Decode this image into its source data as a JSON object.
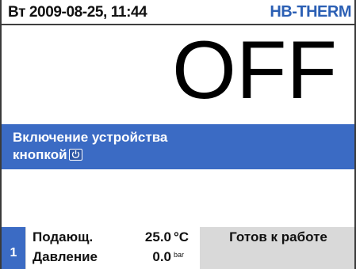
{
  "topbar": {
    "datetime": "Вт 2009-08-25, 11:44",
    "brand": "HB-THERM"
  },
  "main": {
    "state": "OFF"
  },
  "banner": {
    "line1": "Включение устройства",
    "line2": "кнопкой",
    "icon": "power-key-icon"
  },
  "footer": {
    "slot_number": "1",
    "rows": [
      {
        "label": "Подающ.",
        "value": "25.0",
        "unit": "°C"
      },
      {
        "label": "Давление",
        "value": "0.0",
        "unit": "bar"
      }
    ],
    "status": "Готов к работе"
  },
  "colors": {
    "accent": "#3b6bc4",
    "brand": "#2b5fb4",
    "status_bar": "#d9d9d9"
  }
}
